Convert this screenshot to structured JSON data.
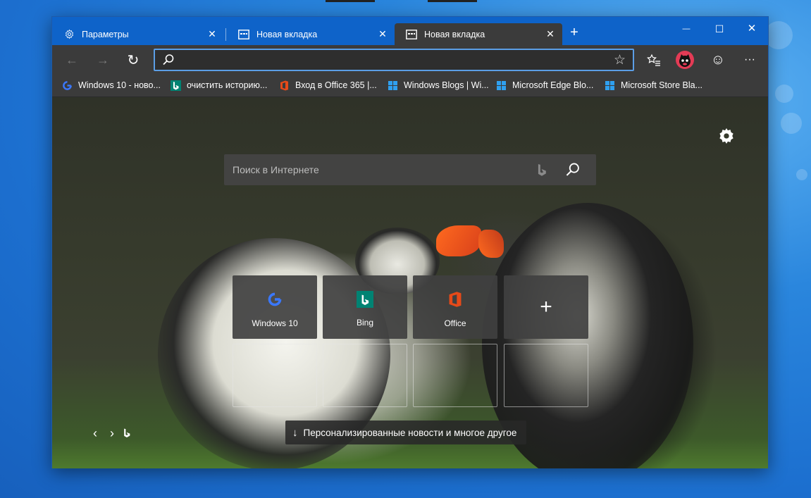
{
  "tabs": [
    {
      "label": "Параметры",
      "icon": "gear-icon",
      "active": false
    },
    {
      "label": "Новая вкладка",
      "icon": "new-tab-page-icon",
      "active": false
    },
    {
      "label": "Новая вкладка",
      "icon": "new-tab-page-icon",
      "active": true
    }
  ],
  "tab_close_glyph": "✕",
  "new_tab_glyph": "+",
  "window_controls": {
    "minimize": "—",
    "maximize": "☐",
    "close": "✕"
  },
  "toolbar": {
    "back": "←",
    "forward": "→",
    "refresh": "↻",
    "address_value": "",
    "favorite_star": "☆",
    "favorites_list": "☆≡",
    "feedback": "☺",
    "more": "···"
  },
  "favorites": [
    {
      "label": "Windows 10 - ново...",
      "icon": "windows10-site-icon"
    },
    {
      "label": "очистить историю...",
      "icon": "bing-icon"
    },
    {
      "label": "Вход в Office 365 |...",
      "icon": "office-icon"
    },
    {
      "label": "Windows Blogs | Wi...",
      "icon": "windows-logo-icon"
    },
    {
      "label": "Microsoft Edge Blo...",
      "icon": "windows-logo-icon"
    },
    {
      "label": "Microsoft Store Bla...",
      "icon": "windows-logo-icon"
    }
  ],
  "new_tab_page": {
    "search_placeholder": "Поиск в Интернете",
    "tiles": [
      {
        "label": "Windows 10",
        "icon": "windows10-site-icon"
      },
      {
        "label": "Bing",
        "icon": "bing-icon"
      },
      {
        "label": "Office",
        "icon": "office-icon"
      },
      {
        "label": "",
        "icon": "add-icon"
      }
    ],
    "add_glyph": "+",
    "news_label": "Персонализированные новости и многое другое",
    "news_arrow": "↓",
    "prev_image": "‹",
    "next_image": "›"
  },
  "colors": {
    "accent": "#0e63c9",
    "address_focus": "#5b9ee6",
    "bing_teal": "#008373",
    "office_orange": "#e64a19",
    "windows_blue": "#2f7ff0",
    "avatar_red": "#e33b55"
  }
}
